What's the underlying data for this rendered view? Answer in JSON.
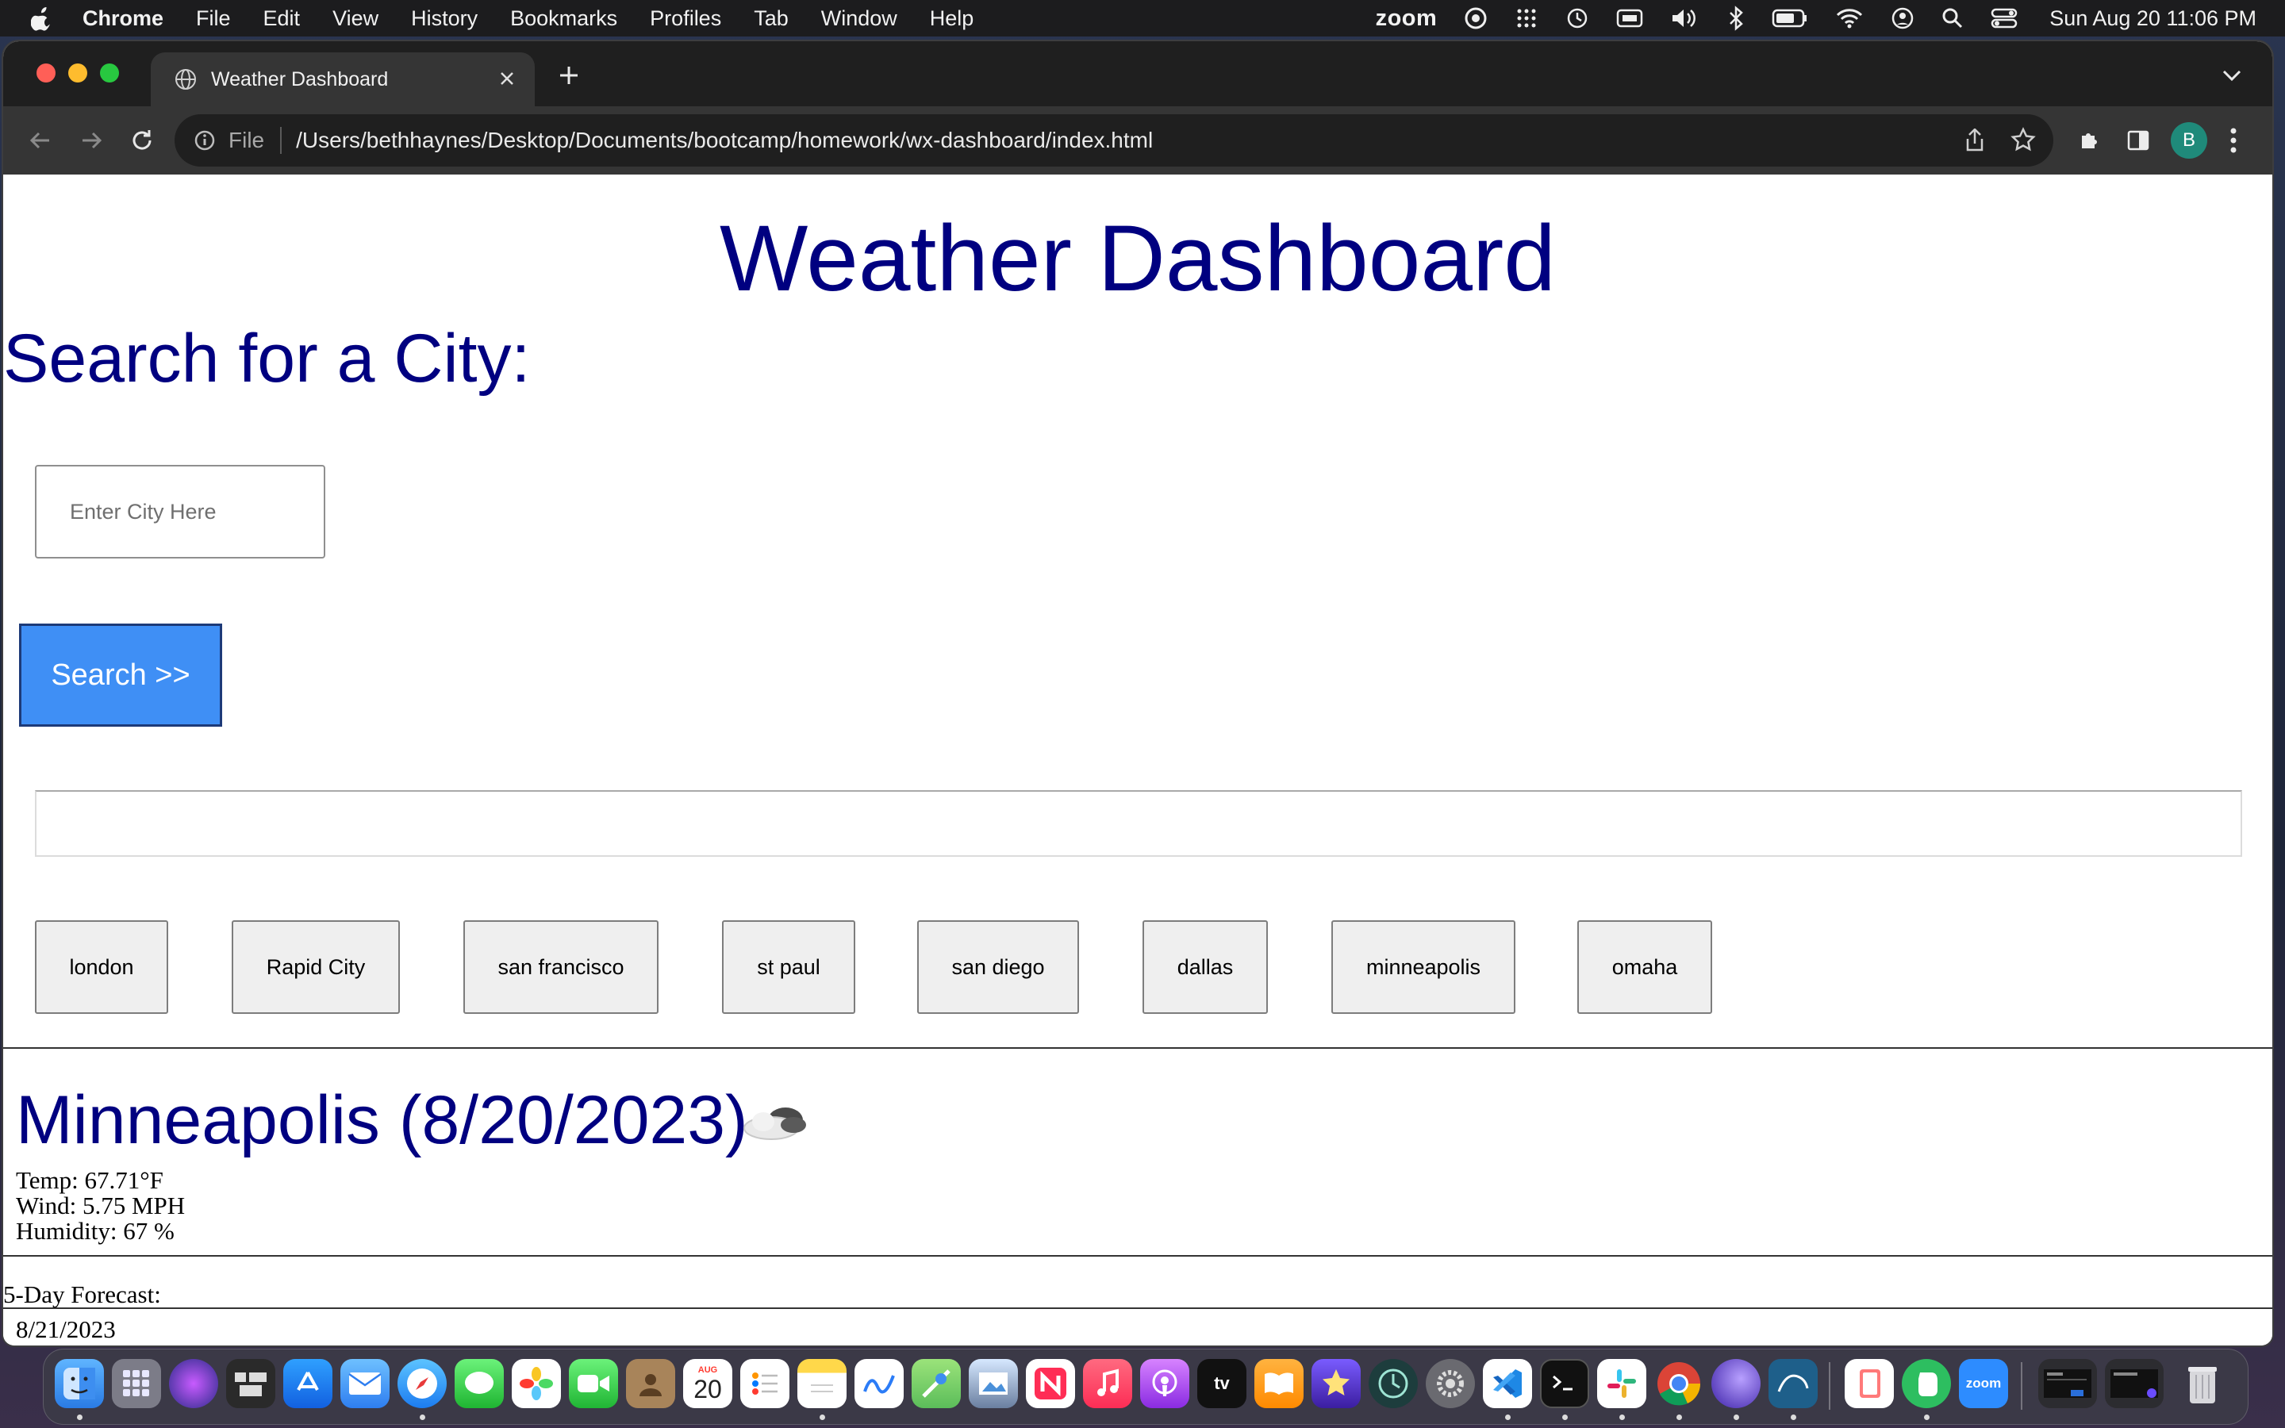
{
  "menubar": {
    "app_name": "Chrome",
    "items": [
      "File",
      "Edit",
      "View",
      "History",
      "Bookmarks",
      "Profiles",
      "Tab",
      "Window",
      "Help"
    ],
    "status_word": "zoom",
    "clock": "Sun Aug 20  11:06 PM"
  },
  "browser": {
    "tab_title": "Weather Dashboard",
    "omnibox_scheme": "File",
    "url": "/Users/bethhaynes/Desktop/Documents/bootcamp/homework/wx-dashboard/index.html",
    "profile_initial": "B"
  },
  "page": {
    "title": "Weather Dashboard",
    "search_heading": "Search for a City:",
    "search_placeholder": "Enter City Here",
    "search_value": "",
    "search_button": "Search >>",
    "history_buttons": [
      "london",
      "Rapid City",
      "san francisco",
      "st paul",
      "san diego",
      "dallas",
      "minneapolis",
      "omaha"
    ],
    "current": {
      "heading": "Minneapolis (8/20/2023)",
      "icon": "cloud-icon",
      "temp": "Temp: 67.71°F",
      "wind": "Wind: 5.75 MPH",
      "humidity": "Humidity: 67 %"
    },
    "forecast_label": "5-Day Forecast:",
    "forecast": [
      {
        "date": "8/21/2023",
        "icon": "cloud-icon"
      }
    ]
  },
  "dock": {
    "calendar_month": "AUG",
    "calendar_day": "20",
    "zoom_label": "zoom",
    "tv_label": "tv"
  },
  "colors": {
    "heading_navy": "#000080",
    "search_button_blue": "#3f8ff5",
    "chrome_dark": "#353535"
  }
}
